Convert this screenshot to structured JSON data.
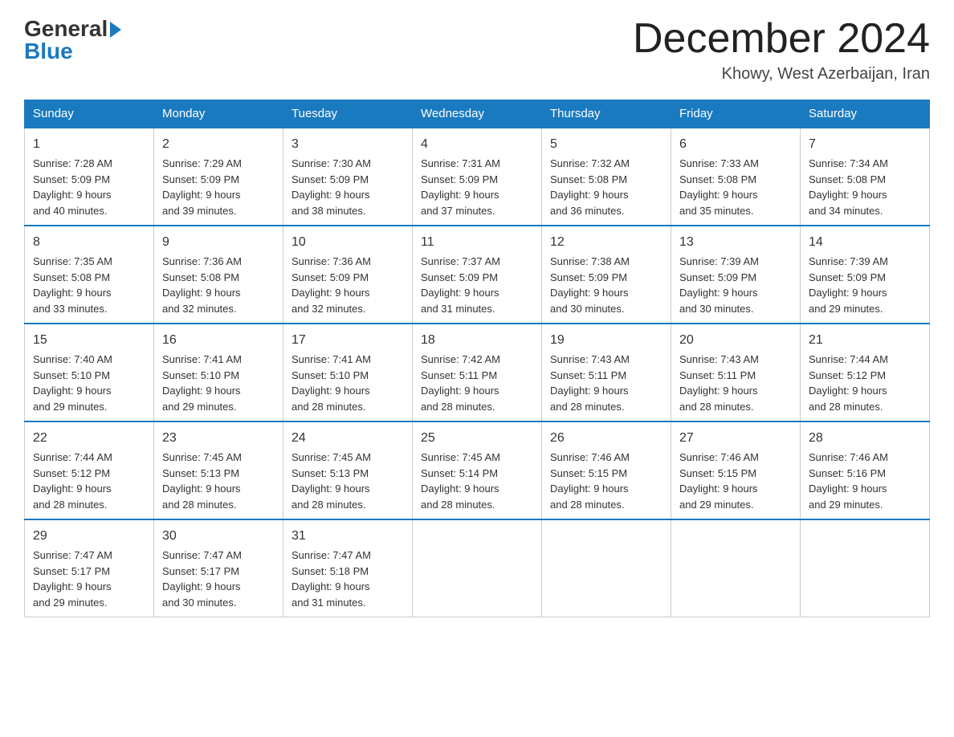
{
  "logo": {
    "general_text": "General",
    "blue_text": "Blue"
  },
  "title": "December 2024",
  "subtitle": "Khowy, West Azerbaijan, Iran",
  "days_of_week": [
    "Sunday",
    "Monday",
    "Tuesday",
    "Wednesday",
    "Thursday",
    "Friday",
    "Saturday"
  ],
  "weeks": [
    [
      {
        "day": "1",
        "info": "Sunrise: 7:28 AM\nSunset: 5:09 PM\nDaylight: 9 hours\nand 40 minutes."
      },
      {
        "day": "2",
        "info": "Sunrise: 7:29 AM\nSunset: 5:09 PM\nDaylight: 9 hours\nand 39 minutes."
      },
      {
        "day": "3",
        "info": "Sunrise: 7:30 AM\nSunset: 5:09 PM\nDaylight: 9 hours\nand 38 minutes."
      },
      {
        "day": "4",
        "info": "Sunrise: 7:31 AM\nSunset: 5:09 PM\nDaylight: 9 hours\nand 37 minutes."
      },
      {
        "day": "5",
        "info": "Sunrise: 7:32 AM\nSunset: 5:08 PM\nDaylight: 9 hours\nand 36 minutes."
      },
      {
        "day": "6",
        "info": "Sunrise: 7:33 AM\nSunset: 5:08 PM\nDaylight: 9 hours\nand 35 minutes."
      },
      {
        "day": "7",
        "info": "Sunrise: 7:34 AM\nSunset: 5:08 PM\nDaylight: 9 hours\nand 34 minutes."
      }
    ],
    [
      {
        "day": "8",
        "info": "Sunrise: 7:35 AM\nSunset: 5:08 PM\nDaylight: 9 hours\nand 33 minutes."
      },
      {
        "day": "9",
        "info": "Sunrise: 7:36 AM\nSunset: 5:08 PM\nDaylight: 9 hours\nand 32 minutes."
      },
      {
        "day": "10",
        "info": "Sunrise: 7:36 AM\nSunset: 5:09 PM\nDaylight: 9 hours\nand 32 minutes."
      },
      {
        "day": "11",
        "info": "Sunrise: 7:37 AM\nSunset: 5:09 PM\nDaylight: 9 hours\nand 31 minutes."
      },
      {
        "day": "12",
        "info": "Sunrise: 7:38 AM\nSunset: 5:09 PM\nDaylight: 9 hours\nand 30 minutes."
      },
      {
        "day": "13",
        "info": "Sunrise: 7:39 AM\nSunset: 5:09 PM\nDaylight: 9 hours\nand 30 minutes."
      },
      {
        "day": "14",
        "info": "Sunrise: 7:39 AM\nSunset: 5:09 PM\nDaylight: 9 hours\nand 29 minutes."
      }
    ],
    [
      {
        "day": "15",
        "info": "Sunrise: 7:40 AM\nSunset: 5:10 PM\nDaylight: 9 hours\nand 29 minutes."
      },
      {
        "day": "16",
        "info": "Sunrise: 7:41 AM\nSunset: 5:10 PM\nDaylight: 9 hours\nand 29 minutes."
      },
      {
        "day": "17",
        "info": "Sunrise: 7:41 AM\nSunset: 5:10 PM\nDaylight: 9 hours\nand 28 minutes."
      },
      {
        "day": "18",
        "info": "Sunrise: 7:42 AM\nSunset: 5:11 PM\nDaylight: 9 hours\nand 28 minutes."
      },
      {
        "day": "19",
        "info": "Sunrise: 7:43 AM\nSunset: 5:11 PM\nDaylight: 9 hours\nand 28 minutes."
      },
      {
        "day": "20",
        "info": "Sunrise: 7:43 AM\nSunset: 5:11 PM\nDaylight: 9 hours\nand 28 minutes."
      },
      {
        "day": "21",
        "info": "Sunrise: 7:44 AM\nSunset: 5:12 PM\nDaylight: 9 hours\nand 28 minutes."
      }
    ],
    [
      {
        "day": "22",
        "info": "Sunrise: 7:44 AM\nSunset: 5:12 PM\nDaylight: 9 hours\nand 28 minutes."
      },
      {
        "day": "23",
        "info": "Sunrise: 7:45 AM\nSunset: 5:13 PM\nDaylight: 9 hours\nand 28 minutes."
      },
      {
        "day": "24",
        "info": "Sunrise: 7:45 AM\nSunset: 5:13 PM\nDaylight: 9 hours\nand 28 minutes."
      },
      {
        "day": "25",
        "info": "Sunrise: 7:45 AM\nSunset: 5:14 PM\nDaylight: 9 hours\nand 28 minutes."
      },
      {
        "day": "26",
        "info": "Sunrise: 7:46 AM\nSunset: 5:15 PM\nDaylight: 9 hours\nand 28 minutes."
      },
      {
        "day": "27",
        "info": "Sunrise: 7:46 AM\nSunset: 5:15 PM\nDaylight: 9 hours\nand 29 minutes."
      },
      {
        "day": "28",
        "info": "Sunrise: 7:46 AM\nSunset: 5:16 PM\nDaylight: 9 hours\nand 29 minutes."
      }
    ],
    [
      {
        "day": "29",
        "info": "Sunrise: 7:47 AM\nSunset: 5:17 PM\nDaylight: 9 hours\nand 29 minutes."
      },
      {
        "day": "30",
        "info": "Sunrise: 7:47 AM\nSunset: 5:17 PM\nDaylight: 9 hours\nand 30 minutes."
      },
      {
        "day": "31",
        "info": "Sunrise: 7:47 AM\nSunset: 5:18 PM\nDaylight: 9 hours\nand 31 minutes."
      },
      {
        "day": "",
        "info": ""
      },
      {
        "day": "",
        "info": ""
      },
      {
        "day": "",
        "info": ""
      },
      {
        "day": "",
        "info": ""
      }
    ]
  ]
}
